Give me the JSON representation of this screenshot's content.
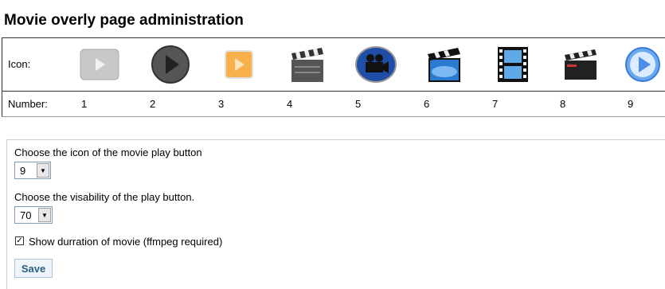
{
  "page": {
    "title": "Movie overly page administration"
  },
  "icon_table": {
    "icon_label": "Icon:",
    "number_label": "Number:",
    "icons": [
      {
        "number": "1",
        "icon": "gray-square-play-icon"
      },
      {
        "number": "2",
        "icon": "dark-circle-play-icon"
      },
      {
        "number": "3",
        "icon": "orange-square-play-icon"
      },
      {
        "number": "4",
        "icon": "clapperboard-icon"
      },
      {
        "number": "5",
        "icon": "blue-camera-icon"
      },
      {
        "number": "6",
        "icon": "blue-clapper-icon"
      },
      {
        "number": "7",
        "icon": "film-strip-icon"
      },
      {
        "number": "8",
        "icon": "black-clapperboard-icon"
      },
      {
        "number": "9",
        "icon": "blue-circle-play-icon"
      }
    ]
  },
  "form": {
    "icon_choice_label": "Choose the icon of the movie play button",
    "icon_choice_value": "9",
    "visibility_label": "Choose the visability of the play button.",
    "visibility_value": "70",
    "duration_checkbox_label": "Show durration of movie (ffmpeg required)",
    "duration_checked": true,
    "save_label": "Save"
  },
  "colors": {
    "save_text": "#2b5d86",
    "save_bg": "#eef4f9"
  }
}
